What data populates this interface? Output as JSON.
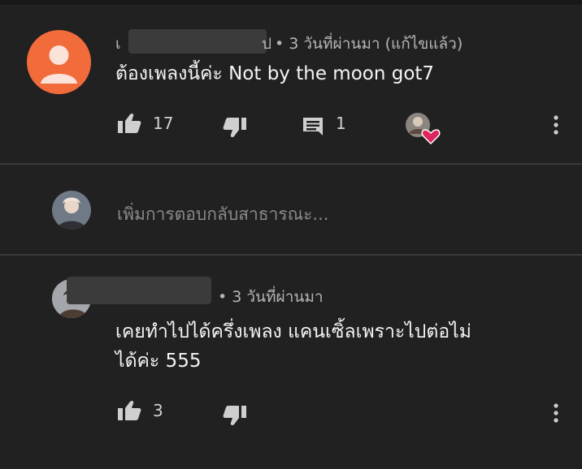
{
  "comment1": {
    "username_prefix": "เ",
    "username_suffix": "ป",
    "meta": "• 3 วันที่ผ่านมา (แก้ไขแล้ว)",
    "text": "ต้องเพลงนี้ค่ะ Not by the moon  got7",
    "likes": "17",
    "replies": "1"
  },
  "reply_box": {
    "placeholder": "เพิ่มการตอบกลับสาธารณะ..."
  },
  "comment2": {
    "meta": "• 3 วันที่ผ่านมา",
    "text_line1": "เคยทำไปได้ครึ่งเพลง แคนเซิ้ลเพราะไปต่อไม่",
    "text_line2": "ได้ค่ะ 555",
    "likes": "3"
  },
  "colors": {
    "background": "#212121",
    "default_avatar": "#f26b3a",
    "heart": "#e0245e"
  },
  "icons": [
    "thumb-up-icon",
    "thumb-down-icon",
    "reply-icon",
    "creator-heart-icon",
    "more-options-icon"
  ]
}
